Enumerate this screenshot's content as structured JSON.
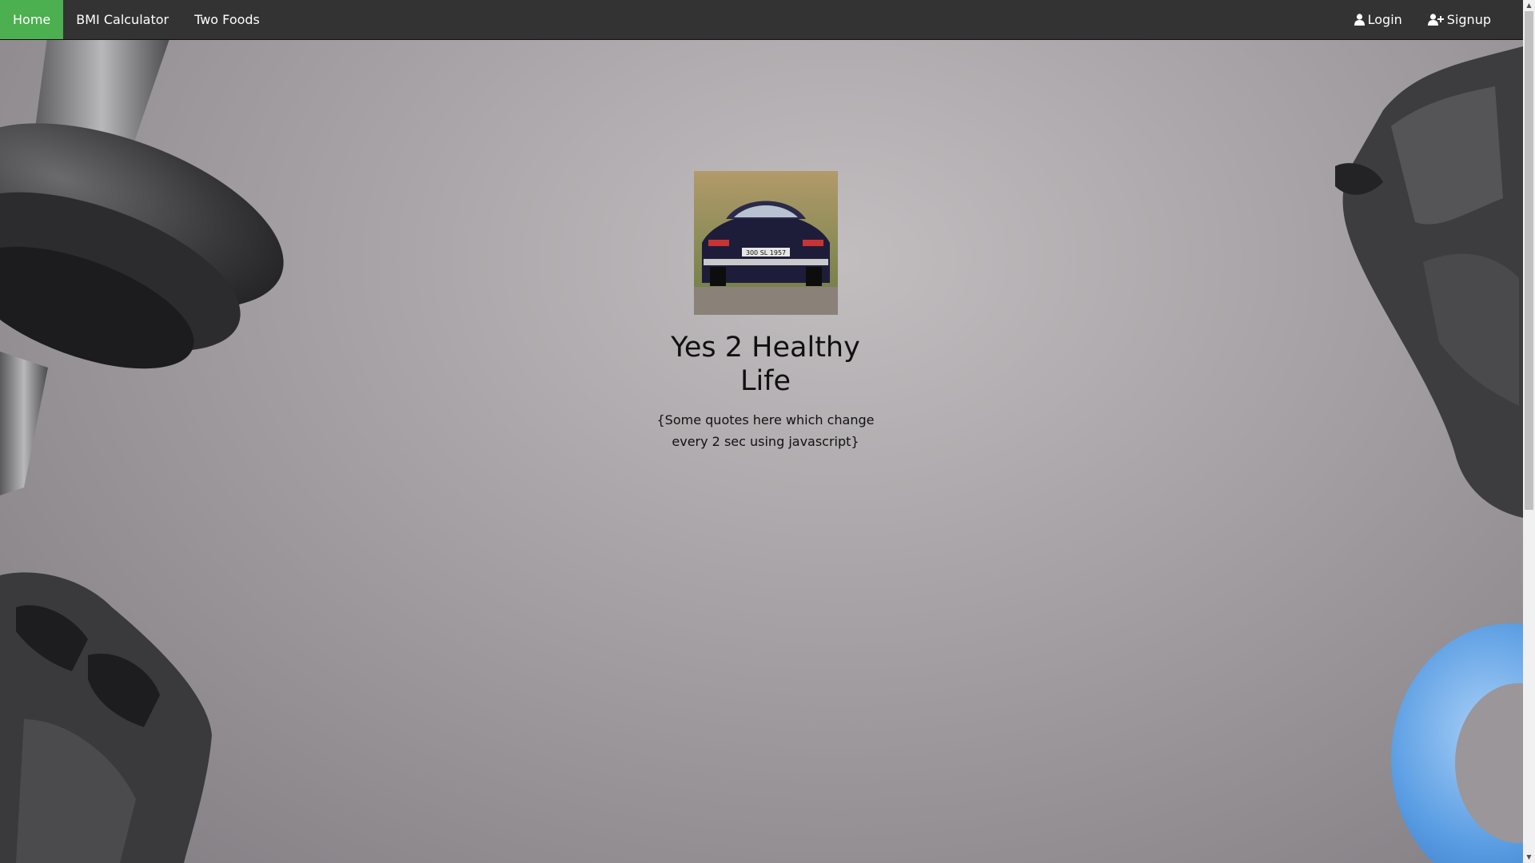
{
  "navbar": {
    "left_items": [
      {
        "label": "Home",
        "active": true
      },
      {
        "label": "BMI Calculator",
        "active": false
      },
      {
        "label": "Two Foods",
        "active": false
      }
    ],
    "login_label": "Login",
    "signup_label": "Signup",
    "login_icon": "user-icon",
    "signup_icon": "user-plus-icon"
  },
  "hero": {
    "image_plate_text": "300 SL 1957",
    "title": "Yes 2 Healthy Life",
    "quote": "{Some quotes here which change every 2 sec using javascript}"
  },
  "colors": {
    "navbar_bg": "#333333",
    "active_bg": "#4caf50",
    "nav_text": "#ffffff",
    "page_bg": "#a8a4a7"
  }
}
